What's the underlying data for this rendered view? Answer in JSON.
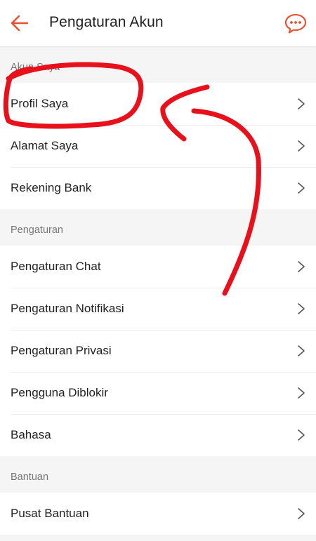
{
  "header": {
    "title": "Pengaturan Akun",
    "back_icon": "arrow-left-icon",
    "chat_icon": "chat-bubble-icon",
    "accent_color": "#ee4d2d"
  },
  "sections": [
    {
      "title": "Akun Saya",
      "items": [
        "Profil Saya",
        "Alamat Saya",
        "Rekening Bank"
      ]
    },
    {
      "title": "Pengaturan",
      "items": [
        "Pengaturan Chat",
        "Pengaturan Notifikasi",
        "Pengaturan Privasi",
        "Pengguna Diblokir",
        "Bahasa"
      ]
    },
    {
      "title": "Bantuan",
      "items": [
        "Pusat Bantuan"
      ]
    }
  ],
  "annotation": {
    "color": "#e8101a",
    "shapes": [
      "circle-around-profil-saya",
      "curved-arrow-pointing-to-profil-saya"
    ]
  }
}
